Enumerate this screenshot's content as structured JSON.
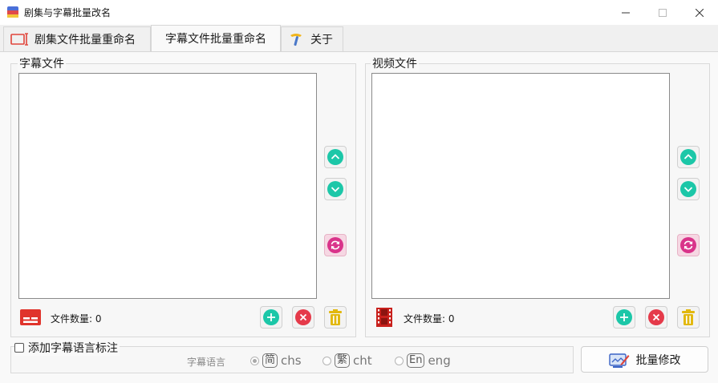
{
  "window": {
    "title": "剧集与字幕批量改名"
  },
  "tabs": [
    {
      "label": "剧集文件批量重命名",
      "icon": "rename-icon"
    },
    {
      "label": "字幕文件批量重命名",
      "active": true
    },
    {
      "label": "关于",
      "icon": "hammer-icon"
    }
  ],
  "subtitle_panel": {
    "title": "字幕文件",
    "count_label": "文件数量:",
    "count": "0"
  },
  "video_panel": {
    "title": "视频文件",
    "count_label": "文件数量:",
    "count": "0"
  },
  "options": {
    "add_lang_label": "添加字幕语言标注",
    "lang_label": "字幕语言",
    "langs": [
      {
        "badge": "简",
        "code": "chs",
        "selected": true
      },
      {
        "badge": "繁",
        "code": "cht",
        "selected": false
      },
      {
        "badge": "En",
        "code": "eng",
        "selected": false
      }
    ]
  },
  "batch_button": {
    "label": "批量修改"
  },
  "colors": {
    "teal": "#1cc7a8",
    "red": "#e53a4a",
    "pink": "#d9338a",
    "gold": "#e2b80f"
  }
}
